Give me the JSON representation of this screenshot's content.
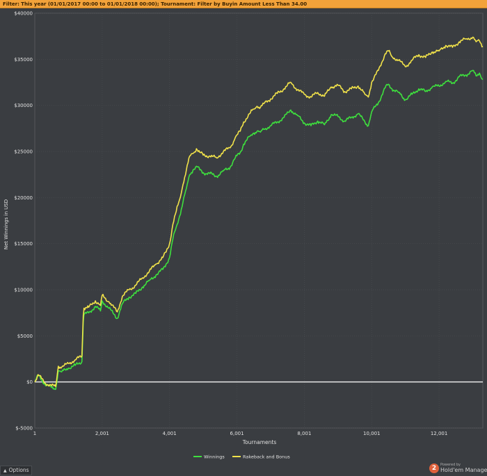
{
  "filter_bar": {
    "label": "Filter:",
    "text": "This year (01/01/2017 00:00 to 01/01/2018 00:00); Tournament: Filter by Buyin Amount Less Than 34.00"
  },
  "options_button": {
    "label": "Options",
    "icon": "triangle-up-icon"
  },
  "branding": {
    "logo_text": "2",
    "powered": "Powered by",
    "name": "Hold'em Manager"
  },
  "colors": {
    "background": "#3a3d41",
    "grid": "#4a4d51",
    "winnings": "#3ee03e",
    "rakeback": "#f2e34a",
    "zero_line": "#e8e8e8"
  },
  "chart_data": {
    "type": "line",
    "xlabel": "Tournaments",
    "ylabel": "Net Winnings in USD",
    "xlim": [
      1,
      13300
    ],
    "ylim": [
      -5000,
      40000
    ],
    "x_ticks": [
      {
        "value": 1,
        "label": "1"
      },
      {
        "value": 2001,
        "label": "2,001"
      },
      {
        "value": 4001,
        "label": "4,001"
      },
      {
        "value": 6001,
        "label": "6,001"
      },
      {
        "value": 8001,
        "label": "8,001"
      },
      {
        "value": 10001,
        "label": "10,001"
      },
      {
        "value": 12001,
        "label": "12,001"
      }
    ],
    "y_ticks": [
      {
        "value": -5000,
        "label": "$-5000"
      },
      {
        "value": 0,
        "label": "$0"
      },
      {
        "value": 5000,
        "label": "$5000"
      },
      {
        "value": 10000,
        "label": "$10000"
      },
      {
        "value": 15000,
        "label": "$15000"
      },
      {
        "value": 20000,
        "label": "$20000"
      },
      {
        "value": 25000,
        "label": "$25000"
      },
      {
        "value": 30000,
        "label": "$30000"
      },
      {
        "value": 35000,
        "label": "$35000"
      },
      {
        "value": 40000,
        "label": "$40000"
      }
    ],
    "grid": true,
    "legend_position": "bottom-center",
    "series": [
      {
        "name": "Winnings",
        "x": [
          1,
          100,
          300,
          500,
          620,
          700,
          800,
          1000,
          1200,
          1400,
          1440,
          1460,
          1600,
          1800,
          1950,
          2000,
          2200,
          2450,
          2600,
          2800,
          3000,
          3200,
          3400,
          3600,
          3800,
          3900,
          4000,
          4100,
          4200,
          4300,
          4400,
          4500,
          4600,
          4700,
          4800,
          4900,
          5000,
          5200,
          5400,
          5600,
          5800,
          5950,
          6100,
          6200,
          6400,
          6500,
          6600,
          6700,
          6800,
          7000,
          7200,
          7400,
          7600,
          7800,
          8000,
          8200,
          8400,
          8600,
          8800,
          9000,
          9200,
          9400,
          9600,
          9800,
          9900,
          10000,
          10200,
          10400,
          10500,
          10600,
          10800,
          11000,
          11200,
          11400,
          11600,
          11800,
          12000,
          12200,
          12400,
          12600,
          12800,
          13000,
          13100,
          13200,
          13300
        ],
        "y": [
          0,
          700,
          -200,
          -600,
          -800,
          1200,
          1100,
          1500,
          1800,
          2200,
          6500,
          7300,
          7500,
          8200,
          7700,
          8800,
          8000,
          6900,
          8500,
          9200,
          9600,
          10300,
          11000,
          11600,
          12200,
          12800,
          13500,
          15500,
          16800,
          18000,
          19500,
          21000,
          22500,
          23000,
          23400,
          23000,
          22700,
          22600,
          22300,
          22900,
          23300,
          24300,
          24900,
          25800,
          26700,
          27000,
          27200,
          27100,
          27400,
          27800,
          28200,
          28700,
          29500,
          28900,
          28100,
          27800,
          28300,
          27900,
          29000,
          28800,
          28300,
          28700,
          29100,
          28200,
          27800,
          29300,
          30300,
          31900,
          32300,
          31800,
          31400,
          30600,
          31200,
          31800,
          31500,
          32000,
          32100,
          32600,
          32400,
          33100,
          33300,
          33800,
          33200,
          33500,
          32800
        ]
      },
      {
        "name": "Rakeback and Bonus",
        "x": [
          1,
          100,
          300,
          500,
          620,
          700,
          800,
          1000,
          1200,
          1400,
          1440,
          1460,
          1600,
          1800,
          1950,
          2000,
          2200,
          2450,
          2600,
          2800,
          3000,
          3200,
          3400,
          3600,
          3800,
          3900,
          4000,
          4100,
          4200,
          4300,
          4400,
          4500,
          4600,
          4700,
          4800,
          4900,
          5000,
          5200,
          5400,
          5600,
          5800,
          5950,
          6100,
          6200,
          6400,
          6500,
          6600,
          6700,
          6800,
          7000,
          7200,
          7400,
          7600,
          7800,
          8000,
          8200,
          8400,
          8600,
          8800,
          9000,
          9200,
          9400,
          9600,
          9800,
          9900,
          10000,
          10200,
          10400,
          10500,
          10600,
          10800,
          11000,
          11200,
          11400,
          11600,
          11800,
          12000,
          12200,
          12400,
          12600,
          12800,
          13000,
          13100,
          13200,
          13300
        ],
        "y": [
          0,
          800,
          -100,
          -400,
          -500,
          1700,
          1600,
          2000,
          2400,
          2800,
          7200,
          8000,
          8100,
          8800,
          8300,
          9400,
          8700,
          7600,
          9300,
          10000,
          10500,
          11300,
          12000,
          12800,
          13500,
          14100,
          15000,
          17100,
          18500,
          19800,
          21400,
          23000,
          24500,
          24800,
          25300,
          24900,
          24600,
          24500,
          24300,
          25000,
          25400,
          26500,
          27200,
          28200,
          29200,
          29600,
          29900,
          29800,
          30200,
          30700,
          31300,
          31800,
          32500,
          31700,
          31200,
          30900,
          31400,
          31000,
          32000,
          32200,
          31500,
          31800,
          32100,
          31200,
          30900,
          32500,
          33800,
          35600,
          35900,
          35300,
          34900,
          34200,
          34900,
          35500,
          35200,
          35800,
          35900,
          36500,
          36300,
          36900,
          37200,
          37400,
          36900,
          37000,
          36400
        ]
      }
    ]
  }
}
